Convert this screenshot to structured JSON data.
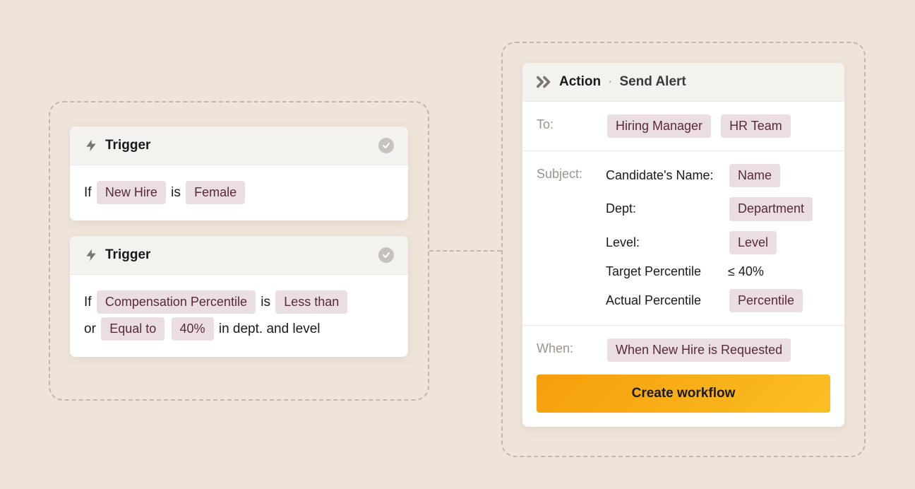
{
  "triggers": [
    {
      "title": "Trigger",
      "condition_prefix": "If",
      "chip1": "New Hire",
      "mid1": "is",
      "chip2": "Female"
    },
    {
      "title": "Trigger",
      "line1_prefix": "If",
      "chip1": "Compensation Percentile",
      "mid1": "is",
      "chip2": "Less than",
      "line2_prefix": "or",
      "chip3": "Equal to",
      "chip4": "40%",
      "suffix": "in dept. and level"
    }
  ],
  "action": {
    "header_label": "Action",
    "header_value": "Send Alert",
    "to_label": "To:",
    "to_recipients": [
      "Hiring Manager",
      "HR Team"
    ],
    "subject_label": "Subject:",
    "subject_rows": [
      {
        "label": "Candidate's Name:",
        "chip": "Name"
      },
      {
        "label": "Dept:",
        "chip": "Department"
      },
      {
        "label": "Level:",
        "chip": "Level"
      },
      {
        "label": "Target Percentile",
        "plain": "≤ 40%"
      },
      {
        "label": "Actual Percentile",
        "chip": "Percentile"
      }
    ],
    "when_label": "When:",
    "when_value": "When New Hire is Requested",
    "cta": "Create workflow"
  }
}
